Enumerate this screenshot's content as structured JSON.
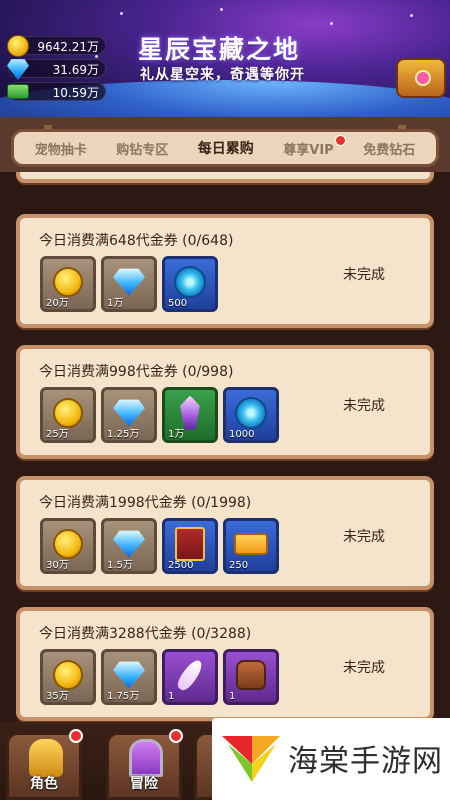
{
  "header": {
    "title": "星辰宝藏之地",
    "subtitle": "礼从星空来，奇遇等你开",
    "currencies": [
      {
        "icon": "coin-icon",
        "value": "9642.21万"
      },
      {
        "icon": "diamond-icon",
        "value": "31.69万"
      },
      {
        "icon": "cash-icon",
        "value": "10.59万"
      }
    ]
  },
  "tabs": [
    {
      "label": "宠物抽卡",
      "active": false
    },
    {
      "label": "购钻专区",
      "active": false
    },
    {
      "label": "每日累购",
      "active": true
    },
    {
      "label": "尊享VIP",
      "active": false,
      "badge": true
    },
    {
      "label": "免费钻石",
      "active": false
    }
  ],
  "rewards": [
    {
      "title": "今日消费满648代金券 (0/648)",
      "status": "未完成",
      "items": [
        {
          "icon": "gold-coin-icon",
          "qty": "20万",
          "frame": "brown"
        },
        {
          "icon": "diamond-icon",
          "qty": "1万",
          "frame": "brown"
        },
        {
          "icon": "blue-orb-icon",
          "qty": "500",
          "frame": "blue"
        }
      ]
    },
    {
      "title": "今日消费满998代金券 (0/998)",
      "status": "未完成",
      "items": [
        {
          "icon": "gold-coin-icon",
          "qty": "25万",
          "frame": "brown"
        },
        {
          "icon": "diamond-icon",
          "qty": "1.25万",
          "frame": "brown"
        },
        {
          "icon": "purple-crystal-icon",
          "qty": "1万",
          "frame": "green"
        },
        {
          "icon": "blue-orb-icon",
          "qty": "1000",
          "frame": "blue"
        }
      ]
    },
    {
      "title": "今日消费满1998代金券 (0/1998)",
      "status": "未完成",
      "items": [
        {
          "icon": "gold-coin-icon",
          "qty": "30万",
          "frame": "brown"
        },
        {
          "icon": "diamond-icon",
          "qty": "1.5万",
          "frame": "brown"
        },
        {
          "icon": "spell-book-icon",
          "qty": "2500",
          "frame": "blue"
        },
        {
          "icon": "golden-ticket-icon",
          "qty": "250",
          "frame": "blue"
        }
      ]
    },
    {
      "title": "今日消费满3288代金券 (0/3288)",
      "status": "未完成",
      "items": [
        {
          "icon": "gold-coin-icon",
          "qty": "35万",
          "frame": "brown"
        },
        {
          "icon": "diamond-icon",
          "qty": "1.75万",
          "frame": "brown"
        },
        {
          "icon": "feather-icon",
          "qty": "1",
          "frame": "purple"
        },
        {
          "icon": "backpack-icon",
          "qty": "1",
          "frame": "purple"
        }
      ]
    }
  ],
  "bottom_nav": [
    {
      "label": "角色",
      "badge": true
    },
    {
      "label": "冒险",
      "badge": true
    }
  ],
  "watermark": {
    "text": "海棠手游网"
  }
}
